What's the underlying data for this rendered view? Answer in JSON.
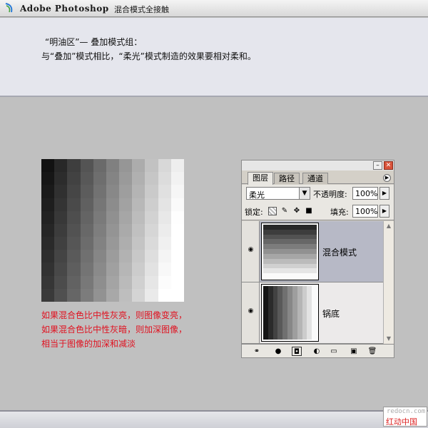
{
  "window": {
    "app_title": "Adobe Photoshop",
    "subtitle": "混合模式全接触"
  },
  "banner": {
    "line1": "“明油区”— 叠加模式组：",
    "line2": "与“叠加”模式相比，“柔光”模式制造的效果要相对柔和。"
  },
  "gradient_grid": {
    "columns": 11,
    "rows": 11
  },
  "note": {
    "text": "如果混合色比中性灰亮，则图像变亮，如果混合色比中性灰暗，则加深图像，相当于图像的加深和减淡"
  },
  "panel": {
    "tabs": [
      "图层",
      "路径",
      "通道"
    ],
    "active_tab": 0,
    "blend_mode": "柔光",
    "opacity_label": "不透明度:",
    "opacity_value": "100%",
    "lock_label": "锁定:",
    "fill_label": "填充:",
    "fill_value": "100%",
    "layers": [
      {
        "name": "混合模式",
        "selected": true,
        "thumb": "horizontal-bands"
      },
      {
        "name": "锅底",
        "selected": false,
        "thumb": "vertical-bands"
      }
    ],
    "icons": {
      "lock_transparency": "checker-icon",
      "lock_paint": "brush-icon",
      "lock_move": "move-icon",
      "lock_all": "lock-icon",
      "bottom": [
        "link-icon",
        "fx-icon",
        "mask-icon",
        "adjustment-icon",
        "folder-icon",
        "new-layer-icon",
        "trash-icon"
      ]
    }
  },
  "watermark": {
    "url": "redocn.com",
    "brand": "红动中国"
  }
}
